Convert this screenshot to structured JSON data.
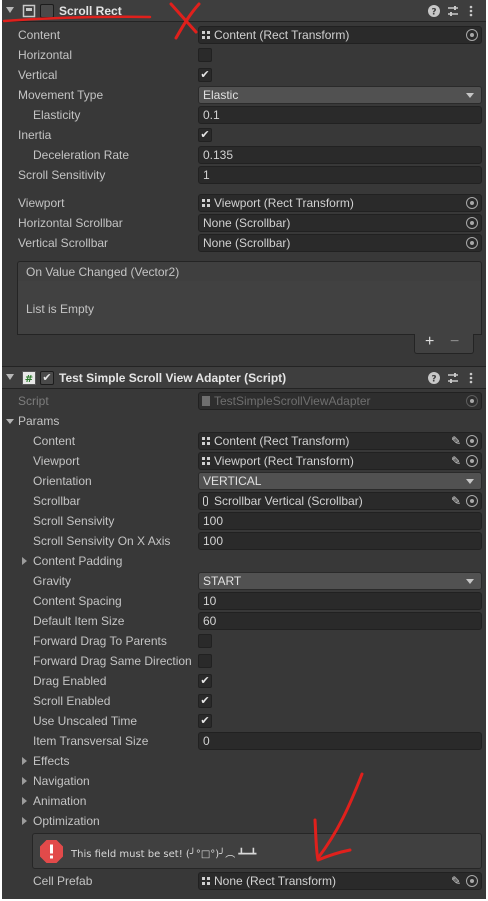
{
  "scroll_rect": {
    "title": "Scroll Rect",
    "content_label": "Content",
    "content_value": "Content (Rect Transform)",
    "horizontal_label": "Horizontal",
    "vertical_label": "Vertical",
    "movement_type_label": "Movement Type",
    "movement_type_value": "Elastic",
    "elasticity_label": "Elasticity",
    "elasticity_value": "0.1",
    "inertia_label": "Inertia",
    "deceleration_rate_label": "Deceleration Rate",
    "deceleration_rate_value": "0.135",
    "scroll_sensitivity_label": "Scroll Sensitivity",
    "scroll_sensitivity_value": "1",
    "viewport_label": "Viewport",
    "viewport_value": "Viewport (Rect Transform)",
    "horizontal_scrollbar_label": "Horizontal Scrollbar",
    "horizontal_scrollbar_value": "None (Scrollbar)",
    "vertical_scrollbar_label": "Vertical Scrollbar",
    "vertical_scrollbar_value": "None (Scrollbar)",
    "event_title": "On Value Changed (Vector2)",
    "event_empty": "List is Empty",
    "add_label": "+",
    "remove_label": "−"
  },
  "adapter": {
    "title": "Test Simple Scroll View Adapter (Script)",
    "script_label": "Script",
    "script_value": "TestSimpleScrollViewAdapter",
    "params_label": "Params",
    "content_label": "Content",
    "content_value": "Content (Rect Transform)",
    "viewport_label": "Viewport",
    "viewport_value": "Viewport (Rect Transform)",
    "orientation_label": "Orientation",
    "orientation_value": "VERTICAL",
    "scrollbar_label": "Scrollbar",
    "scrollbar_value": "Scrollbar Vertical (Scrollbar)",
    "scroll_sensivity_label": "Scroll Sensivity",
    "scroll_sensivity_value": "100",
    "scroll_sensivity_x_label": "Scroll Sensivity On X Axis",
    "scroll_sensivity_x_value": "100",
    "content_padding_label": "Content Padding",
    "gravity_label": "Gravity",
    "gravity_value": "START",
    "content_spacing_label": "Content Spacing",
    "content_spacing_value": "10",
    "default_item_size_label": "Default Item Size",
    "default_item_size_value": "60",
    "forward_drag_label": "Forward Drag To Parents",
    "forward_drag_same_label": "Forward Drag Same Direction",
    "drag_enabled_label": "Drag Enabled",
    "scroll_enabled_label": "Scroll Enabled",
    "use_unscaled_time_label": "Use Unscaled Time",
    "item_transversal_size_label": "Item Transversal Size",
    "item_transversal_size_value": "0",
    "effects_label": "Effects",
    "navigation_label": "Navigation",
    "animation_label": "Animation",
    "optimization_label": "Optimization",
    "warning_text": "This field must be set! (╯°□°)╯︵ ┻━┻",
    "cell_prefab_label": "Cell Prefab",
    "cell_prefab_value": "None (Rect Transform)"
  },
  "checks": {
    "horizontal": false,
    "vertical": true,
    "inertia": true,
    "scroll_rect_enabled": false,
    "adapter_enabled": true,
    "forward_drag": false,
    "forward_drag_same": false,
    "drag_enabled": true,
    "scroll_enabled": true,
    "use_unscaled_time": true
  },
  "icons": [
    "help-icon",
    "preset-icon",
    "more-icon",
    "object-picker-icon",
    "pencil-icon",
    "warning-icon",
    "script-icon"
  ],
  "colors": {
    "panel_bg": "#383838",
    "header_bg": "#3e3e3e",
    "field_bg": "#2a2a2a",
    "dropdown_bg": "#515151",
    "text": "#c4c4c4",
    "annotation_red": "#e0201c",
    "warning_red": "#e24a4a"
  }
}
